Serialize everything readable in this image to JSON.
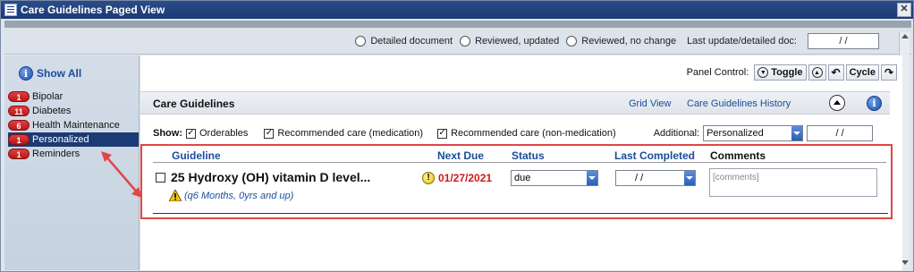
{
  "window": {
    "title": "Care Guidelines Paged View"
  },
  "docbar": {
    "options": [
      "Detailed document",
      "Reviewed, updated",
      "Reviewed, no change"
    ],
    "last_update_label": "Last update/detailed doc:",
    "last_update_value": "  /  /"
  },
  "sidebar": {
    "show_all": "Show All",
    "items": [
      {
        "badge": "1",
        "label": "Bipolar",
        "selected": false
      },
      {
        "badge": "11",
        "label": "Diabetes",
        "selected": false
      },
      {
        "badge": "6",
        "label": "Health Maintenance",
        "selected": false
      },
      {
        "badge": "1",
        "label": "Personalized",
        "selected": true
      },
      {
        "badge": "1",
        "label": "Reminders",
        "selected": false
      }
    ]
  },
  "panel_control": {
    "label": "Panel Control:",
    "toggle": "Toggle",
    "cycle": "Cycle"
  },
  "section": {
    "title": "Care Guidelines",
    "grid_view": "Grid View",
    "history": "Care Guidelines History"
  },
  "show": {
    "label": "Show:",
    "orderables": "Orderables",
    "rec_med": "Recommended care (medication)",
    "rec_nonmed": "Recommended care (non-medication)",
    "additional_label": "Additional:",
    "additional_value": "Personalized",
    "additional_date": "  /  /"
  },
  "columns": {
    "guideline": "Guideline",
    "next_due": "Next Due",
    "status": "Status",
    "last_completed": "Last Completed",
    "comments": "Comments"
  },
  "row": {
    "title": "25 Hydroxy (OH) vitamin D level...",
    "subtitle": "(q6 Months, 0yrs and up)",
    "next_due": "01/27/2021",
    "status": "due",
    "last_completed": "  /  /",
    "comments_placeholder": "[comments]"
  },
  "colors": {
    "title_bar": "#1c3a74",
    "badge": "#d02020",
    "link": "#1a4d9a",
    "due": "#d01818",
    "highlight_box": "#e04646"
  }
}
